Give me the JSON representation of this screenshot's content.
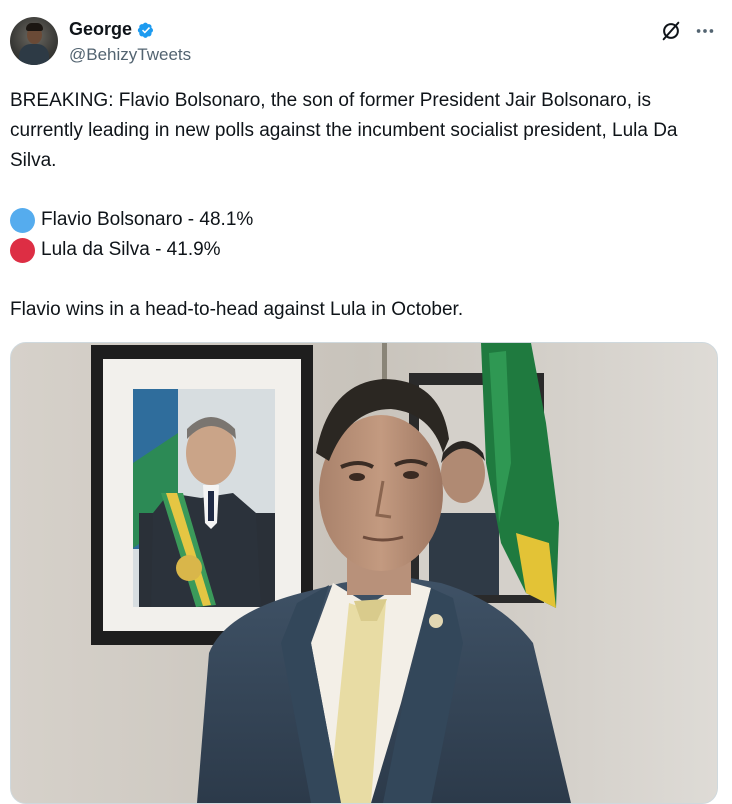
{
  "author": {
    "name": "George",
    "handle": "@BehizyTweets",
    "verified_color": "#1d9bf0"
  },
  "tweet": {
    "paragraph1": "BREAKING: Flavio Bolsonaro, the son of former President Jair Bolsonaro, is currently leading in new polls against the incumbent socialist president, Lula Da Silva.",
    "poll": [
      {
        "label": "Flavio Bolsonaro - 48.1%",
        "color": "#55acee",
        "icon": "blue-circle-icon"
      },
      {
        "label": "Lula da Silva - 41.9%",
        "color": "#dd2e44",
        "icon": "red-circle-icon"
      }
    ],
    "paragraph2": "Flavio wins in a head-to-head against Lula in October."
  },
  "icons": {
    "grok": "grok-icon",
    "more": "more-options-icon"
  }
}
